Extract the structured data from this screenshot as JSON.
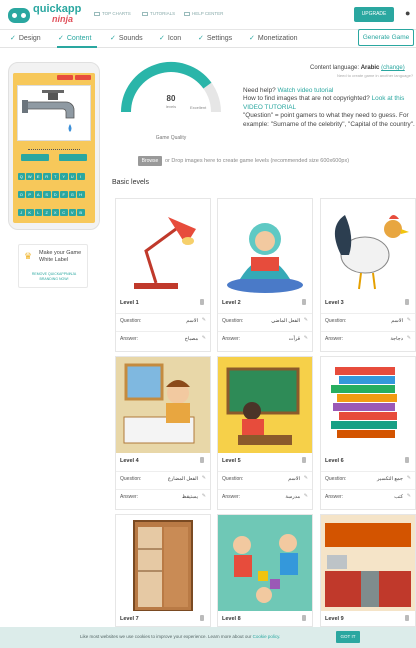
{
  "brand": {
    "name": "quickapp",
    "sub": "ninja"
  },
  "topnav": [
    {
      "label": "TOP CHARTS",
      "icon": "chart-icon"
    },
    {
      "label": "TUTORIALS",
      "icon": "book-icon"
    },
    {
      "label": "HELP CENTER",
      "icon": "help-icon"
    }
  ],
  "upgrade_label": "UPGRADE",
  "tabs": [
    {
      "label": "Design",
      "state": "done"
    },
    {
      "label": "Content",
      "state": "active"
    },
    {
      "label": "Sounds",
      "state": "done"
    },
    {
      "label": "Icon",
      "state": "done"
    },
    {
      "label": "Settings",
      "state": "done"
    },
    {
      "label": "Monetization",
      "state": "done"
    }
  ],
  "generate_label": "Generate Game",
  "preview": {
    "keys": [
      "Q",
      "W",
      "E",
      "R",
      "T",
      "Y",
      "U",
      "I",
      "O",
      "P",
      "A",
      "S",
      "D",
      "F",
      "G",
      "H",
      "J",
      "K",
      "L",
      "Z",
      "X",
      "C",
      "V",
      "B",
      "N",
      "M"
    ]
  },
  "white_label": {
    "title": "Make your Game White Label",
    "remove": "REMOVE QUICKAPPNINJA BRANDING NOW!"
  },
  "quality": {
    "score": "80",
    "score_unit": "levels",
    "max_label": "Excellent",
    "title": "Game Quality",
    "fraction": 0.8
  },
  "language": {
    "prefix": "Content language:",
    "value": "Arabic",
    "change": "(change)",
    "note": "Need to create game in another language?"
  },
  "help": {
    "line1_prefix": "Need help? ",
    "line1_link": "Watch video tutorial",
    "line2_prefix": "How to find images that are not copyrighted? ",
    "line2_link": "Look at this VIDEO TUTORIAL",
    "line3": "\"Question\" = point gamers to what they need to guess. For example: \"Surname of the celebrity\", \"Capital of the country\"."
  },
  "browse": {
    "button": "Browse",
    "text": "or Drop images here to create game levels (recommended size 600x600px)"
  },
  "section_title": "Basic levels",
  "question_label": "Question:",
  "answer_label": "Answer:",
  "levels": [
    {
      "title": "Level 1",
      "question": "الاسم",
      "answer": "مصباح",
      "image": "lamp"
    },
    {
      "title": "Level 2",
      "question": "الفعل الماضي",
      "answer": "قرأت",
      "image": "reading-girl"
    },
    {
      "title": "Level 3",
      "question": "الاسم",
      "answer": "دجاجة",
      "image": "rooster"
    },
    {
      "title": "Level 4",
      "question": "الفعل المضارع",
      "answer": "يستيقظ",
      "image": "waking-boy"
    },
    {
      "title": "Level 5",
      "question": "الاسم",
      "answer": "مدرسة",
      "image": "teacher"
    },
    {
      "title": "Level 6",
      "question": "جمع التكسير",
      "answer": "كتب",
      "image": "books"
    },
    {
      "title": "Level 7",
      "question": "",
      "answer": "",
      "image": "cabinet"
    },
    {
      "title": "Level 8",
      "question": "",
      "answer": "",
      "image": "kids-playing"
    },
    {
      "title": "Level 9",
      "question": "",
      "answer": "",
      "image": "kitchen"
    }
  ],
  "cookie": {
    "text": "Like most websites we use cookies to improve your experience. Learn more about our ",
    "link": "Cookie policy.",
    "button": "GOT IT"
  },
  "colors": {
    "accent": "#2aa7a0",
    "phone_bg": "#f7c85a",
    "cookie_bg": "#dcecea"
  }
}
